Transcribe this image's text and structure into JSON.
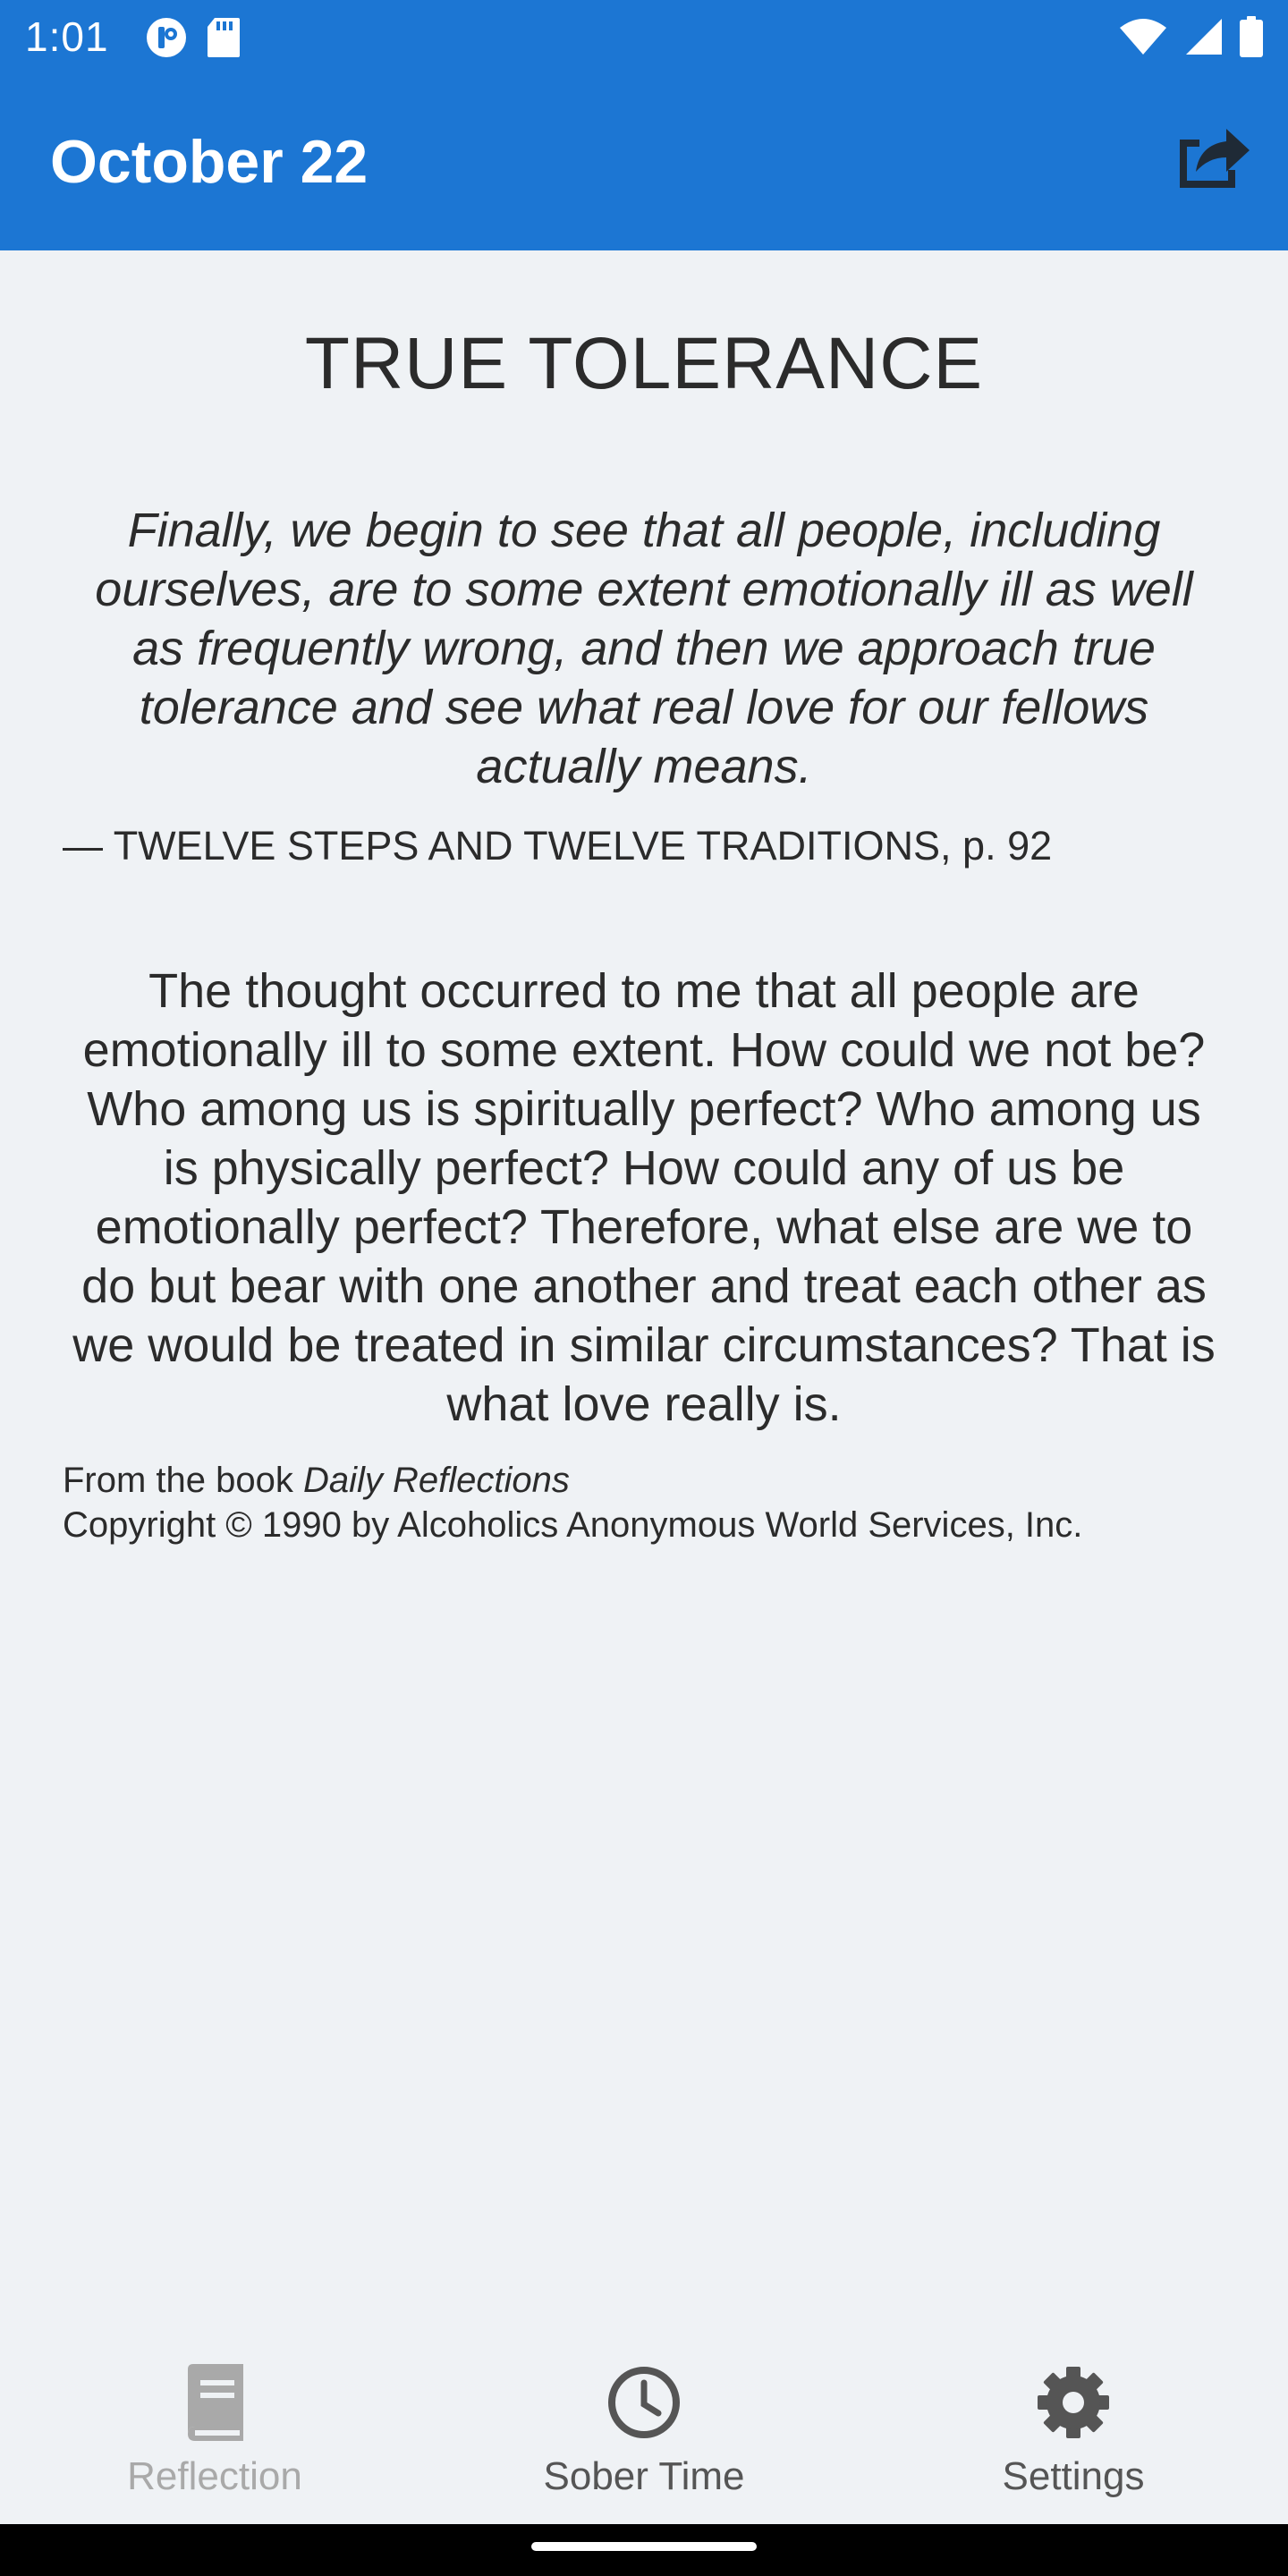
{
  "status_bar": {
    "time": "1:01",
    "left_icons": [
      "notification-app-icon",
      "sd-card-icon"
    ],
    "right_icons": [
      "wifi-icon",
      "signal-icon",
      "battery-icon"
    ]
  },
  "app_bar": {
    "title": "October 22",
    "share_icon": "share-icon",
    "color": "#1c76d3"
  },
  "reflection": {
    "title": "TRUE TOLERANCE",
    "quote": "Finally, we begin to see that all people, including ourselves, are to some extent emotionally ill as well as frequently wrong, and then we approach true tolerance and see what real love for our fellows actually means.",
    "quote_source": "— TWELVE STEPS AND TWELVE TRADITIONS, p. 92",
    "body": "The thought occurred to me that all people are emotionally ill to some extent. How could we not be? Who among us is spiritually perfect? Who among us is physically perfect? How could any of us be emotionally perfect? Therefore, what else are we to do but bear with one another and treat each other as we would be treated in similar circumstances? That is what love really is.",
    "from_prefix": "From the book ",
    "book_title": "Daily Reflections",
    "copyright": "Copyright © 1990 by Alcoholics Anonymous World Services, Inc."
  },
  "bottom_nav": {
    "items": [
      {
        "label": "Reflection",
        "icon": "book-icon",
        "state": "disabled"
      },
      {
        "label": "Sober Time",
        "icon": "clock-icon",
        "state": "normal"
      },
      {
        "label": "Settings",
        "icon": "gear-icon",
        "state": "normal"
      }
    ]
  }
}
